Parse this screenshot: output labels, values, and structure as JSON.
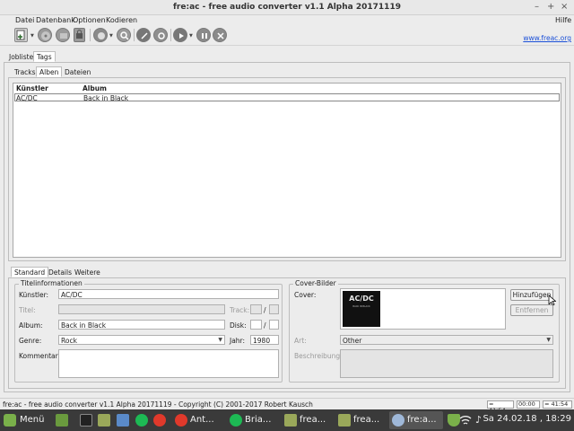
{
  "window": {
    "title": "fre:ac - free audio converter v1.1 Alpha 20171119",
    "controls": [
      "–",
      "+",
      "×"
    ]
  },
  "menu": {
    "items": [
      "Datei",
      "Datenbank",
      "Optionen",
      "Kodieren"
    ],
    "help": "Hilfe"
  },
  "toolbar": {
    "link": "www.freac.org",
    "icons": [
      "add-file-icon",
      "cd-icon",
      "cddb-query-icon",
      "cddb-submit-icon",
      "cd-download-icon",
      "search-icon",
      "edit-icon",
      "settings-icon",
      "gear-icon",
      "play-icon",
      "pause-icon",
      "stop-icon"
    ]
  },
  "main_tabs": [
    "Jobliste",
    "Tags"
  ],
  "sub_tabs": [
    "Tracks",
    "Alben",
    "Dateien"
  ],
  "table": {
    "columns": [
      "Künstler",
      "Album"
    ],
    "rows": [
      {
        "artist": "AC/DC",
        "album": "Back in Black"
      }
    ]
  },
  "detail_tabs": [
    "Standard",
    "Details",
    "Weitere"
  ],
  "title_info": {
    "group_label": "Titelinformationen",
    "kuenstler_label": "Künstler:",
    "kuenstler_value": "AC/DC",
    "titel_label": "Titel:",
    "track_label": "Track:",
    "album_label": "Album:",
    "album_value": "Back in Black",
    "disk_label": "Disk:",
    "slash": "/",
    "genre_label": "Genre:",
    "genre_value": "Rock",
    "jahr_label": "Jahr:",
    "jahr_value": "1980",
    "kommentar_label": "Kommentar:"
  },
  "cover": {
    "group_label": "Cover-Bilder",
    "cover_label": "Cover:",
    "cover_art_text": "AC/DC",
    "cover_art_subtext": "BACK IN BLACK",
    "add_button": "Hinzufügen",
    "remove_button": "Entfernen",
    "art_label": "Art:",
    "art_value": "Other",
    "beschreibung_label": "Beschreibung:"
  },
  "status": {
    "text": "fre:ac - free audio converter v1.1 Alpha 20171119 - Copyright (C) 2001-2017 Robert Kausch",
    "box1": "= 41:54",
    "box2": "00:00",
    "box3": "= 41:54"
  },
  "taskbar": {
    "menu": "Menü",
    "tasks": [
      "Ant...",
      "Bria...",
      "frea...",
      "frea...",
      "fre:a..."
    ],
    "clock": "Sa 24.02.18 , 18:29"
  },
  "colors": {
    "link": "#1a4fd8",
    "taskbar": "#3a3a3a",
    "window_bg": "#ececec"
  }
}
